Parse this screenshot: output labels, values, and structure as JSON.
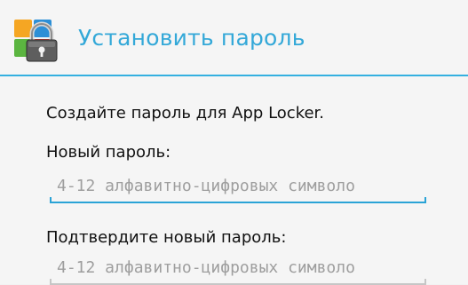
{
  "dialog": {
    "title": "Установить пароль",
    "icon": "app-locker-padlock-icon",
    "accent_color": "#33A8D8"
  },
  "body": {
    "description": "Создайте пароль для App Locker.",
    "new_password": {
      "label": "Новый пароль:",
      "placeholder": "4-12 алфавитно-цифровых символо",
      "focused": true
    },
    "confirm_password": {
      "label": "Подтвердите новый пароль:",
      "placeholder": "4-12 алфавитно-цифровых символо",
      "focused": false
    }
  }
}
